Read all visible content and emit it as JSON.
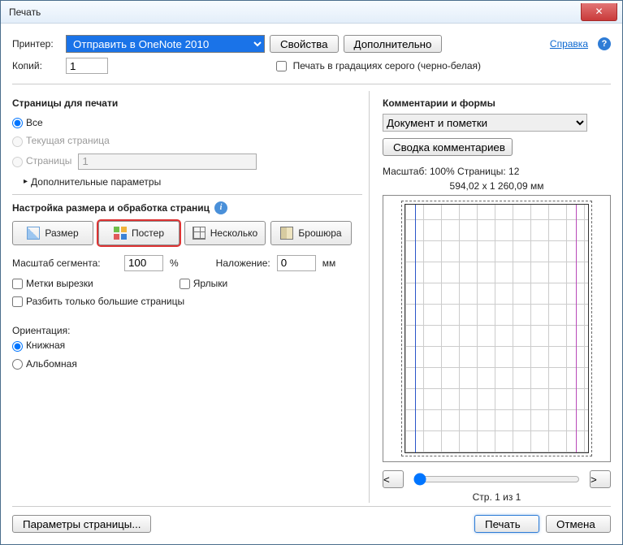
{
  "title": "Печать",
  "printer": {
    "label": "Принтер:",
    "selected": "Отправить в OneNote 2010"
  },
  "buttons": {
    "properties": "Свойства",
    "advanced": "Дополнительно"
  },
  "help": {
    "link": "Справка",
    "iconGlyph": "?"
  },
  "copies": {
    "label": "Копий:",
    "value": "1"
  },
  "grayscale": {
    "label": "Печать в градациях серого (черно-белая)"
  },
  "pages": {
    "header": "Страницы для печати",
    "all": "Все",
    "current": "Текущая страница",
    "range_label": "Страницы",
    "range_value": "1",
    "more_params": "Дополнительные параметры",
    "tri": "▸"
  },
  "sizing": {
    "header": "Настройка размера и обработка страниц",
    "info": "i",
    "size": "Размер",
    "poster": "Постер",
    "multi": "Несколько",
    "booklet": "Брошюра"
  },
  "segment": {
    "label": "Масштаб сегмента:",
    "value": "100",
    "suffix": "%"
  },
  "overlap": {
    "label": "Наложение:",
    "value": "0",
    "suffix": "мм"
  },
  "checks": {
    "cutmarks": "Метки вырезки",
    "labels": "Ярлыки",
    "bigonly": "Разбить только большие страницы"
  },
  "orientation": {
    "header": "Ориентация:",
    "portrait": "Книжная",
    "landscape": "Альбомная"
  },
  "comments": {
    "header": "Комментарии и формы",
    "selected": "Документ и пометки",
    "summary_btn": "Сводка комментариев"
  },
  "preview": {
    "scale_info": "Масштаб: 100% Страницы: 12",
    "dimensions": "594,02 x 1 260,09 мм",
    "page_info": "Стр. 1 из 1"
  },
  "pager": {
    "prev": "<",
    "next": ">"
  },
  "footer": {
    "page_setup": "Параметры страницы...",
    "print": "Печать",
    "cancel": "Отмена"
  },
  "closeGlyph": "✕"
}
